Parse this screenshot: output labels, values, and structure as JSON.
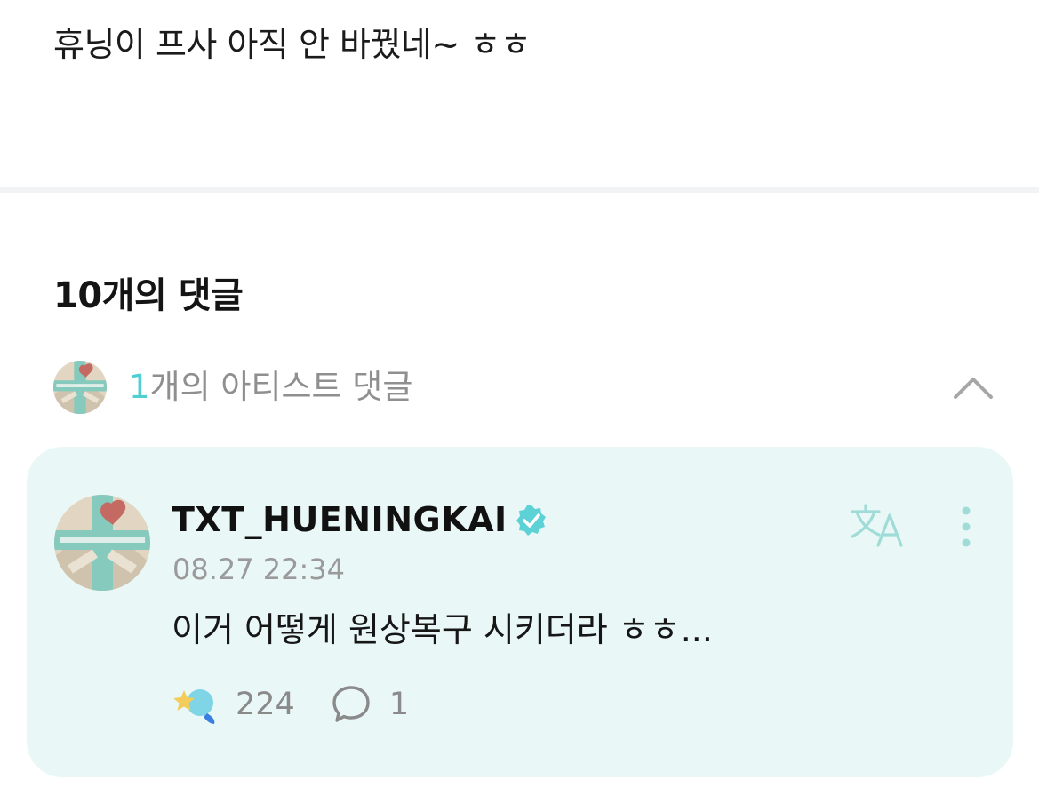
{
  "post": {
    "text": "휴닝이 프사 아직 안 바꿨네~ ㅎㅎ"
  },
  "comments_section": {
    "count_label": "10개의 댓글",
    "artist_bar": {
      "count": "1",
      "label": "개의 아티스트 댓글"
    }
  },
  "artist_comment": {
    "username": "TXT_HUENINGKAI",
    "timestamp": "08.27 22:34",
    "body": "이거 어떻게 원상복구 시키더라 ㅎㅎ...",
    "like_count": "224",
    "reply_count": "1"
  },
  "colors": {
    "accent": "#4fcfd1",
    "card_background": "#e9f8f6",
    "verified_badge": "#5cd1d6"
  },
  "icons": {
    "collapse": "chevron-up-icon",
    "translate": "translate-icon",
    "more": "more-vertical-icon",
    "like": "sparkle-reaction-icon",
    "reply": "speech-bubble-icon",
    "verified": "verified-badge-icon"
  }
}
